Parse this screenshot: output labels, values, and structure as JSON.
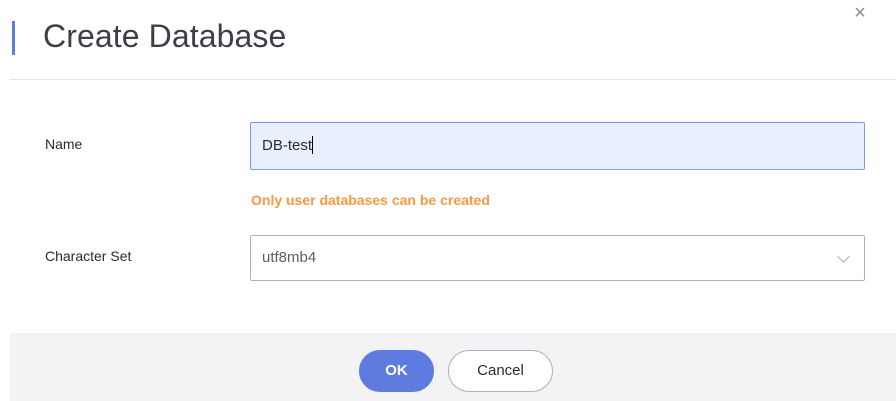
{
  "dialog": {
    "title": "Create Database",
    "close_icon": "×"
  },
  "form": {
    "name_label": "Name",
    "name_value": "DB-test",
    "hint": "Only user databases can be created",
    "charset_label": "Character Set",
    "charset_value": "utf8mb4"
  },
  "footer": {
    "ok_label": "OK",
    "cancel_label": "Cancel"
  },
  "colors": {
    "accent": "#5e7ce0",
    "hint": "#fa9841",
    "input_focus_bg": "#e8f0fe"
  }
}
